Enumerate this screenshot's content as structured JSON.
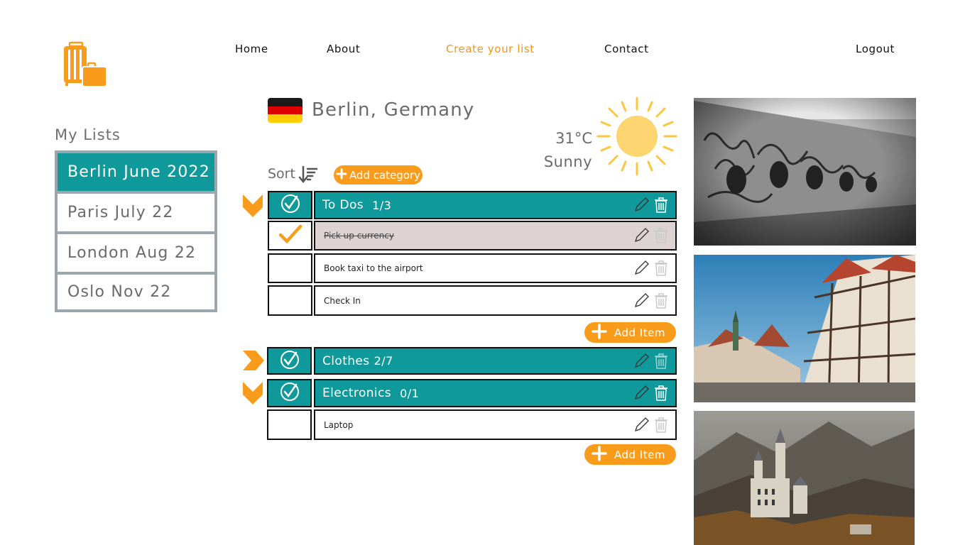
{
  "nav": {
    "home": "Home",
    "about": "About",
    "create": "Create your list",
    "contact": "Contact",
    "logout": "Logout"
  },
  "sidebar": {
    "title": "My Lists",
    "items": [
      {
        "label": "Berlin June 2022",
        "active": true
      },
      {
        "label": "Paris July 22",
        "active": false
      },
      {
        "label": "London Aug 22",
        "active": false
      },
      {
        "label": "Oslo Nov 22",
        "active": false
      }
    ]
  },
  "header": {
    "city": "Berlin, Germany",
    "temperature": "31°C",
    "condition": "Sunny",
    "flag_colors": [
      "#1a1a1a",
      "#dd0000",
      "#ffce00"
    ]
  },
  "toolbar": {
    "sort_label": "Sort",
    "add_category_label": "Add category"
  },
  "categories": [
    {
      "name": "To Dos",
      "count": "1/3",
      "expanded": true,
      "items": [
        {
          "text": "Pick up currency",
          "done": true
        },
        {
          "text": "Book taxi to the airport",
          "done": false
        },
        {
          "text": "Check In",
          "done": false
        }
      ],
      "add_item_label": "Add Item"
    },
    {
      "name": "Clothes",
      "count": "2/7",
      "expanded": false,
      "items": []
    },
    {
      "name": "Electronics",
      "count": "0/1",
      "expanded": true,
      "items": [
        {
          "text": "Laptop",
          "done": false
        }
      ],
      "add_item_label": "Add Item"
    }
  ],
  "colors": {
    "accent": "#f99c1c",
    "teal": "#10999b",
    "done_row": "#ddd3d3",
    "sidebar_border": "#9aa7ad"
  },
  "photos": [
    "berlin-wall-photo",
    "half-timbered-street-photo",
    "castle-photo"
  ]
}
